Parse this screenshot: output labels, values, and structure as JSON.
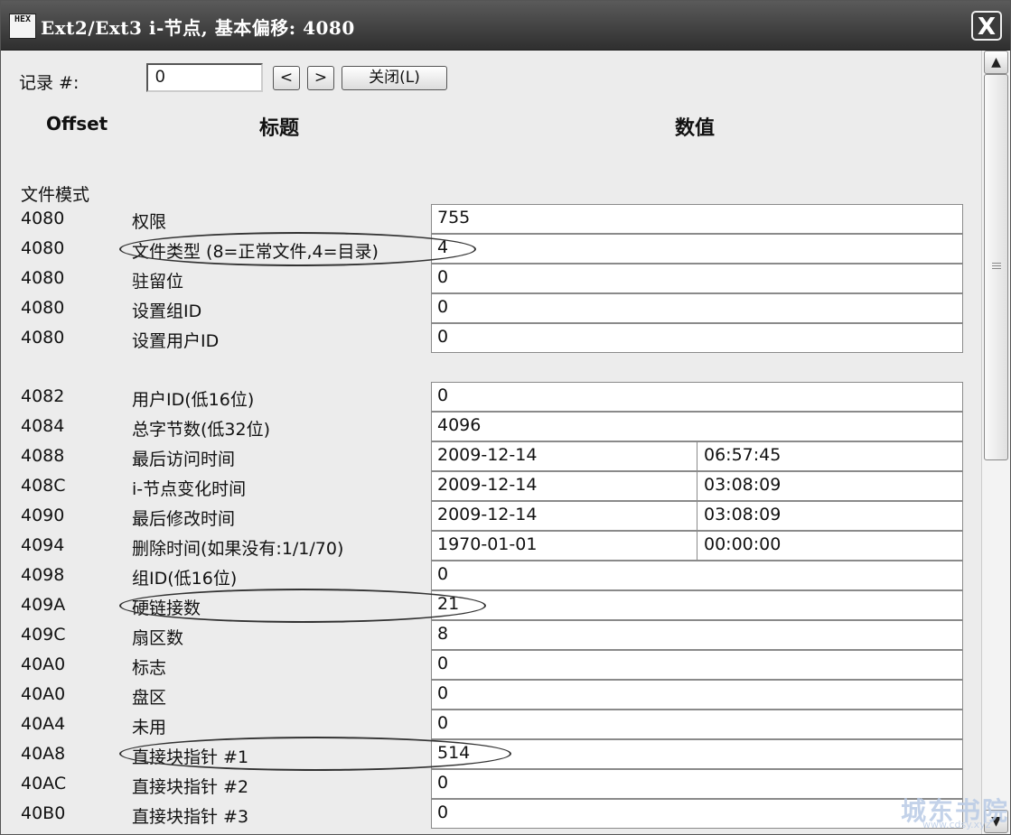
{
  "window": {
    "title": "Ext2/Ext3 i-节点, 基本偏移: 4080",
    "icon_text": "HEX",
    "close_label": "X"
  },
  "toolbar": {
    "record_label": "记录 #:",
    "record_value": "0",
    "prev_label": "<",
    "next_label": ">",
    "close_label": "关闭(L)"
  },
  "headers": {
    "offset": "Offset",
    "title": "标题",
    "value": "数值"
  },
  "section_label": "文件模式",
  "rows_a": [
    {
      "offset": "4080",
      "title": "权限",
      "value": "755"
    },
    {
      "offset": "4080",
      "title": "文件类型 (8=正常文件,4=目录)",
      "value": "4"
    },
    {
      "offset": "4080",
      "title": "驻留位",
      "value": "0"
    },
    {
      "offset": "4080",
      "title": "设置组ID",
      "value": "0"
    },
    {
      "offset": "4080",
      "title": "设置用户ID",
      "value": "0"
    }
  ],
  "rows_b": [
    {
      "offset": "4082",
      "title": "用户ID(低16位)",
      "value": "0"
    },
    {
      "offset": "4084",
      "title": "总字节数(低32位)",
      "value": "4096"
    },
    {
      "offset": "4088",
      "title": "最后访问时间",
      "value": "2009-12-14",
      "value2": "06:57:45"
    },
    {
      "offset": "408C",
      "title": "i-节点变化时间",
      "value": "2009-12-14",
      "value2": "03:08:09"
    },
    {
      "offset": "4090",
      "title": "最后修改时间",
      "value": "2009-12-14",
      "value2": "03:08:09"
    },
    {
      "offset": "4094",
      "title": "删除时间(如果没有:1/1/70)",
      "value": "1970-01-01",
      "value2": "00:00:00"
    },
    {
      "offset": "4098",
      "title": "组ID(低16位)",
      "value": "0"
    },
    {
      "offset": "409A",
      "title": "硬链接数",
      "value": "21"
    },
    {
      "offset": "409C",
      "title": "扇区数",
      "value": "8"
    },
    {
      "offset": "40A0",
      "title": "标志",
      "value": "0"
    },
    {
      "offset": "40A0",
      "title": "盘区",
      "value": "0"
    },
    {
      "offset": "40A4",
      "title": "未用",
      "value": "0"
    },
    {
      "offset": "40A8",
      "title": "直接块指针 #1",
      "value": "514"
    },
    {
      "offset": "40AC",
      "title": "直接块指针 #2",
      "value": "0"
    },
    {
      "offset": "40B0",
      "title": "直接块指针 #3",
      "value": "0"
    }
  ],
  "scrollbar": {
    "up_icon": "▲",
    "down_icon": "▼"
  },
  "watermark": {
    "text": "城东书院",
    "sub": "www.cdsy.xyz"
  }
}
